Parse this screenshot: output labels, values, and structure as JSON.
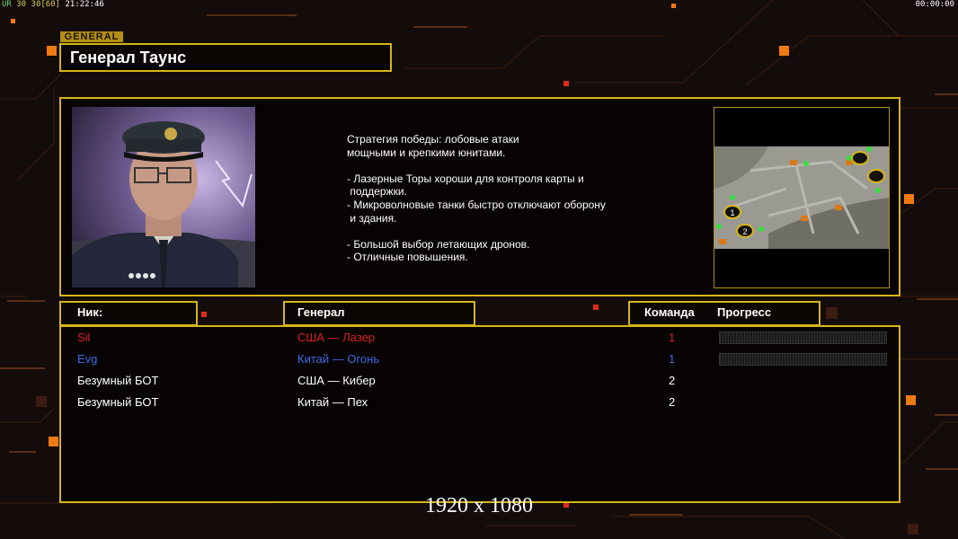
{
  "hud": {
    "left_ur": "UR",
    "left_fps_a": "30",
    "left_fps_b": "30",
    "left_fps_c": "[60]",
    "left_clock": "21:22:46",
    "right_timer": "00:00:00"
  },
  "general_tag": "GENERAL",
  "general_name": "Генерал Таунс",
  "strategy": {
    "lines": [
      "Стратегия победы: лобовые атаки",
      "мощными и крепкими юнитами.",
      "",
      "- Лазерные Торы хороши для контроля карты и",
      " поддержки.",
      "- Микроволновые танки быстро отключают оборону",
      " и здания.",
      "",
      "- Большой выбор летающих дронов.",
      "- Отличные повышения."
    ]
  },
  "minimap": {
    "markers": [
      "1",
      "2"
    ]
  },
  "table": {
    "header_nick": "Ник:",
    "header_general": "Генерал",
    "header_team": "Команда",
    "header_progress": "Прогресс",
    "rows": [
      {
        "nick": "Sil",
        "general": "США — Лазер",
        "team": "1",
        "color": "#e02020",
        "progress": 0
      },
      {
        "nick": "Evg",
        "general": "Китай — Огонь",
        "team": "1",
        "color": "#3c6ae8",
        "progress": 0
      },
      {
        "nick": "Безумный БОТ",
        "general": "США — Кибер",
        "team": "2",
        "color": "#ffffff"
      },
      {
        "nick": "Безумный БОТ",
        "general": "Китай — Пех",
        "team": "2",
        "color": "#ffffff"
      }
    ]
  },
  "resolution": "1920 x 1080",
  "colors": {
    "accent": "#d7b51a",
    "orange": "#f07a12",
    "bg": "#140c0a"
  }
}
